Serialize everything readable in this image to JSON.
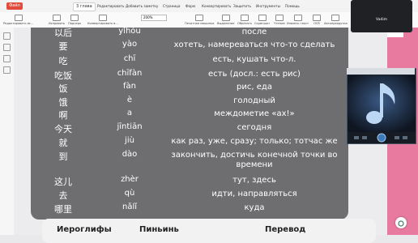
{
  "menubar": {
    "file_tab": "Файл",
    "doc_tab": "3 глава",
    "items": [
      "Редактировать",
      "Добавить заметку",
      "Страница",
      "Форм",
      "Конвертировать",
      "Защитить",
      "Инструменты",
      "Помощь"
    ]
  },
  "toolbar": {
    "edit_all": "Редактировать вс...",
    "tools": [
      "Исправить",
      "Подчерк",
      "Конвертировать в...",
      "Печатная машинка",
      "Выделение",
      "Обрезать",
      "Скриншот",
      "Чтение",
      "Извлечь текст",
      "OCR",
      "Автопрокрутка"
    ],
    "zoom": "200%"
  },
  "video": {
    "participant": "Vadim"
  },
  "table": {
    "rows": [
      {
        "hanzi": "以后",
        "pinyin": "yǐhòu",
        "translation": "после"
      },
      {
        "hanzi": "要",
        "pinyin": "yào",
        "translation": "хотеть, намереваться что-то сделать"
      },
      {
        "hanzi": "吃",
        "pinyin": "chī",
        "translation": "есть, кушать что-л."
      },
      {
        "hanzi": "吃饭",
        "pinyin": "chīfàn",
        "translation": "есть (досл.: есть рис)"
      },
      {
        "hanzi": "饭",
        "pinyin": "fàn",
        "translation": "рис, еда"
      },
      {
        "hanzi": "饿",
        "pinyin": "è",
        "translation": "голодный"
      },
      {
        "hanzi": "啊",
        "pinyin": "a",
        "translation": "междометие «ах!»"
      },
      {
        "hanzi": "今天",
        "pinyin": "jīntiān",
        "translation": "сегодня"
      },
      {
        "hanzi": "就",
        "pinyin": "jiù",
        "translation": "как раз, уже, сразу; только; тотчас же"
      },
      {
        "hanzi": "到",
        "pinyin": "dào",
        "translation": "закончить, достичь конечной точки во времени"
      },
      {
        "hanzi": "这儿",
        "pinyin": "zhèr",
        "translation": "тут, здесь"
      },
      {
        "hanzi": "去",
        "pinyin": "qù",
        "translation": "идти, направляться"
      },
      {
        "hanzi": "哪里",
        "pinyin": "nǎlǐ",
        "translation": "куда"
      }
    ],
    "next_header": {
      "col1": "Иероглифы",
      "col2": "Пиньинь",
      "col3": "Перевод"
    }
  },
  "colors": {
    "pink": "#e8799f",
    "card": "#6e6e71",
    "accent": "#e05a4a",
    "player_note": "#9fc7ef"
  }
}
